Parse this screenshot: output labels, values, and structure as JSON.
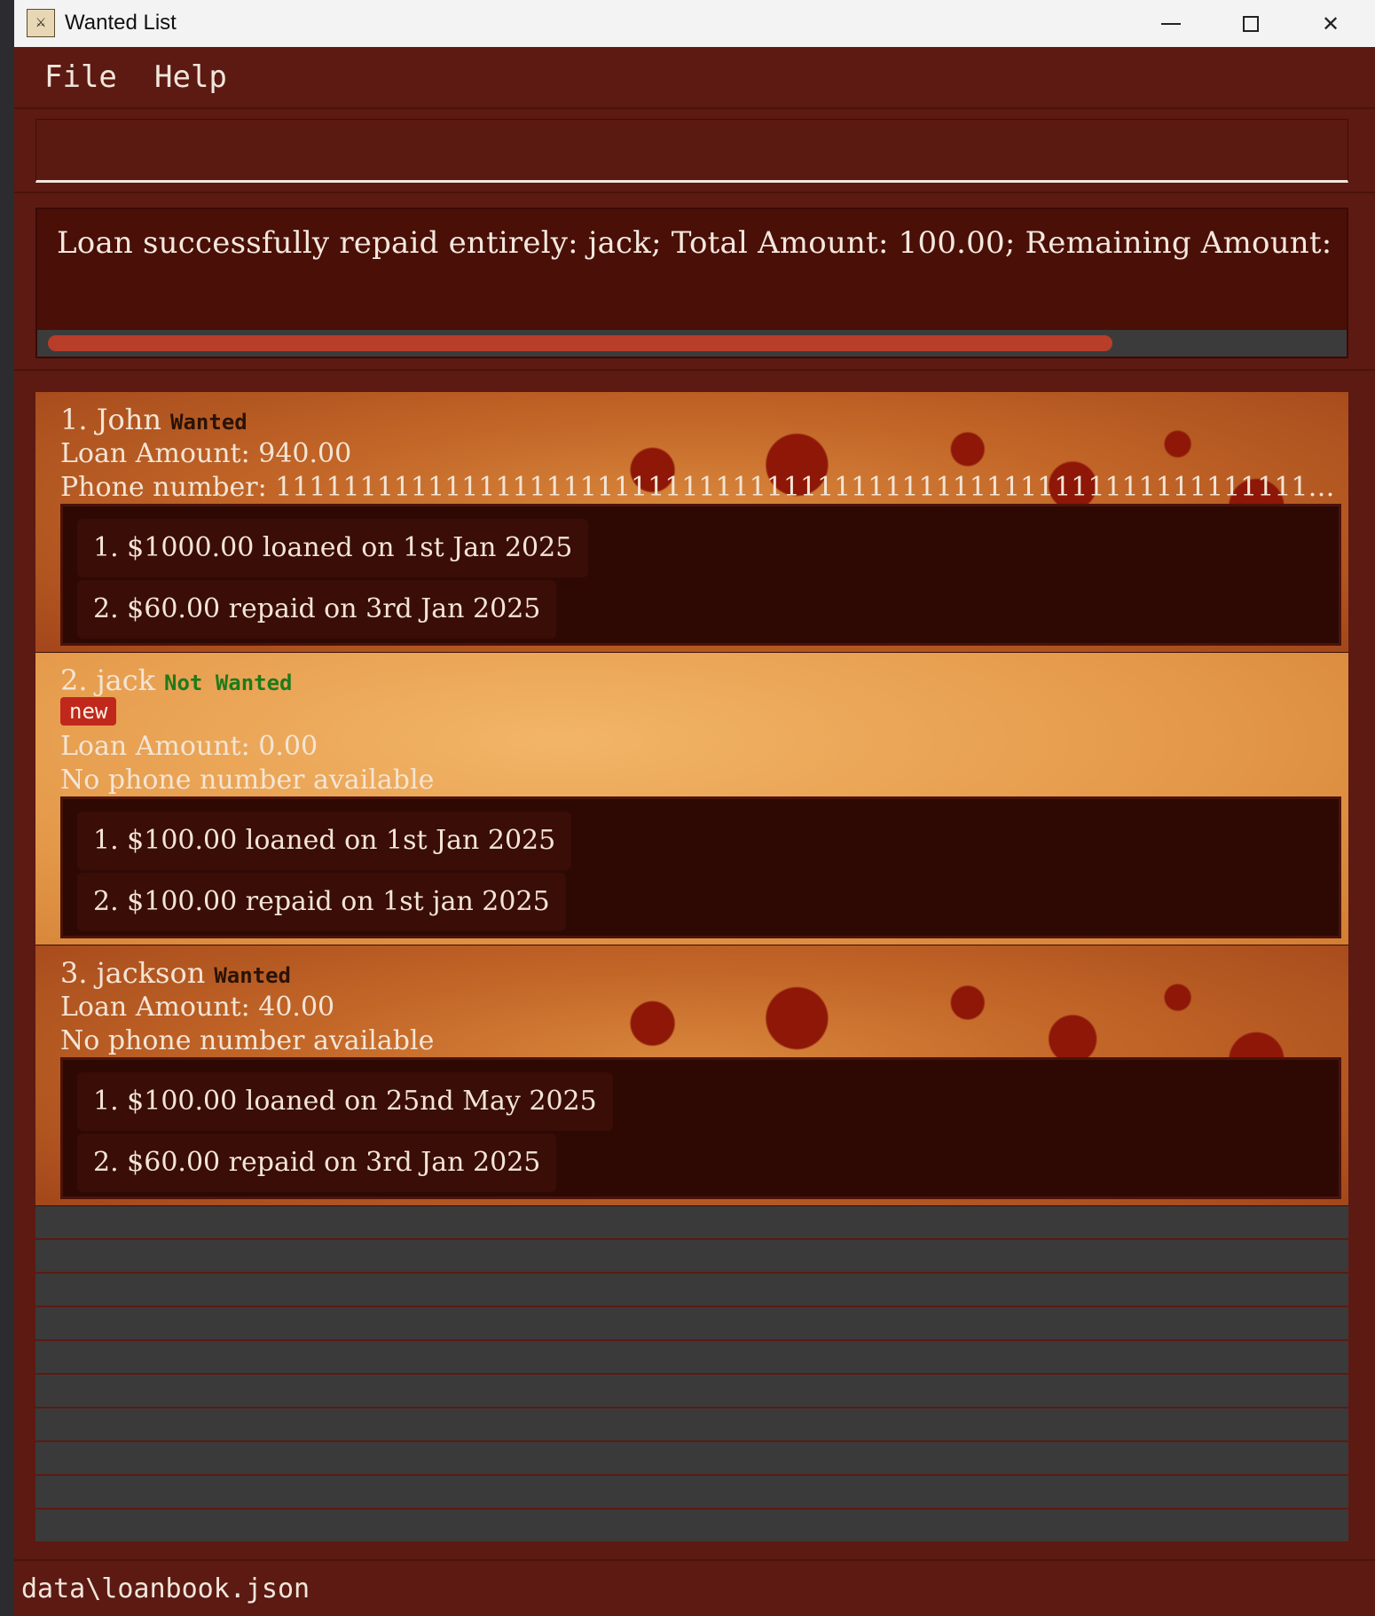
{
  "window": {
    "title": "Wanted List",
    "icon_text": "⚔"
  },
  "menu": {
    "file": "File",
    "help": "Help"
  },
  "command": {
    "value": ""
  },
  "result": {
    "text": "Loan successfully repaid entirely: jack; Total Amount: 100.00; Remaining Amount: "
  },
  "persons": [
    {
      "name": "1. John",
      "tag": "Wanted",
      "loan_amount": "Loan Amount: 940.00",
      "phone": "Phone number: 11111111111111111111111111111111111111111111111111111111111111111...",
      "transactions": [
        "1. $1000.00 loaned on 1st Jan 2025",
        "2. $60.00 repaid on 3rd Jan 2025"
      ]
    },
    {
      "name": "2. jack",
      "tag": "Not Wanted",
      "badge": "new",
      "loan_amount": "Loan Amount: 0.00",
      "phone": "No phone number available",
      "transactions": [
        "1. $100.00 loaned on 1st Jan 2025",
        "2. $100.00 repaid on 1st jan 2025"
      ]
    },
    {
      "name": "3. jackson",
      "tag": "Wanted",
      "loan_amount": "Loan Amount: 40.00",
      "phone": "No phone number available",
      "transactions": [
        "1. $100.00 loaned on 25nd May 2025",
        "2. $60.00 repaid on 3rd Jan 2025"
      ]
    }
  ],
  "status": {
    "path": "data\\loanbook.json"
  },
  "colors": {
    "window_bg": "#5c1a12",
    "result_bg": "#4a0f07",
    "scroll_thumb": "#b83e2a",
    "tx_box_bg": "#2e0904",
    "not_wanted": "#1f7a1a",
    "new_badge": "#c0281c"
  }
}
